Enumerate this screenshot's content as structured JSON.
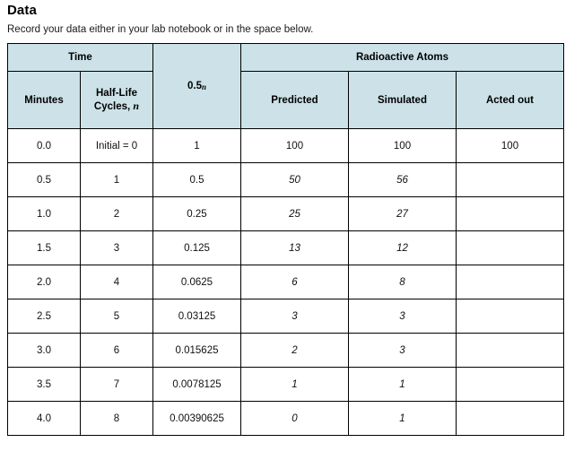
{
  "page": {
    "title": "Data",
    "subtitle": "Record your data either in your lab notebook or in the space below."
  },
  "colors": {
    "header_background": "#cce2e8",
    "border": "#000000",
    "body_background": "#ffffff",
    "text": "#000000"
  },
  "table": {
    "group_headers": {
      "time": "Time",
      "power": "0.5",
      "power_exponent": "n",
      "radioactive_atoms": "Radioactive Atoms"
    },
    "column_headers": {
      "minutes": "Minutes",
      "half_life_cycles_prefix": "Half-Life",
      "half_life_cycles_suffix": "Cycles,",
      "half_life_cycles_var": "n",
      "predicted": "Predicted",
      "simulated": "Simulated",
      "acted_out": "Acted out"
    },
    "rows": [
      {
        "minutes": "0.0",
        "cycles": "Initial = 0",
        "power": "1",
        "predicted": "100",
        "simulated": "100",
        "acted_out": "100",
        "italic": false
      },
      {
        "minutes": "0.5",
        "cycles": "1",
        "power": "0.5",
        "predicted": "50",
        "simulated": "56",
        "acted_out": "",
        "italic": true
      },
      {
        "minutes": "1.0",
        "cycles": "2",
        "power": "0.25",
        "predicted": "25",
        "simulated": "27",
        "acted_out": "",
        "italic": true
      },
      {
        "minutes": "1.5",
        "cycles": "3",
        "power": "0.125",
        "predicted": "13",
        "simulated": "12",
        "acted_out": "",
        "italic": true
      },
      {
        "minutes": "2.0",
        "cycles": "4",
        "power": "0.0625",
        "predicted": "6",
        "simulated": "8",
        "acted_out": "",
        "italic": true
      },
      {
        "minutes": "2.5",
        "cycles": "5",
        "power": "0.03125",
        "predicted": "3",
        "simulated": "3",
        "acted_out": "",
        "italic": true
      },
      {
        "minutes": "3.0",
        "cycles": "6",
        "power": "0.015625",
        "predicted": "2",
        "simulated": "3",
        "acted_out": "",
        "italic": true
      },
      {
        "minutes": "3.5",
        "cycles": "7",
        "power": "0.0078125",
        "predicted": "1",
        "simulated": "1",
        "acted_out": "",
        "italic": true
      },
      {
        "minutes": "4.0",
        "cycles": "8",
        "power": "0.00390625",
        "predicted": "0",
        "simulated": "1",
        "acted_out": "",
        "italic": true
      }
    ]
  }
}
